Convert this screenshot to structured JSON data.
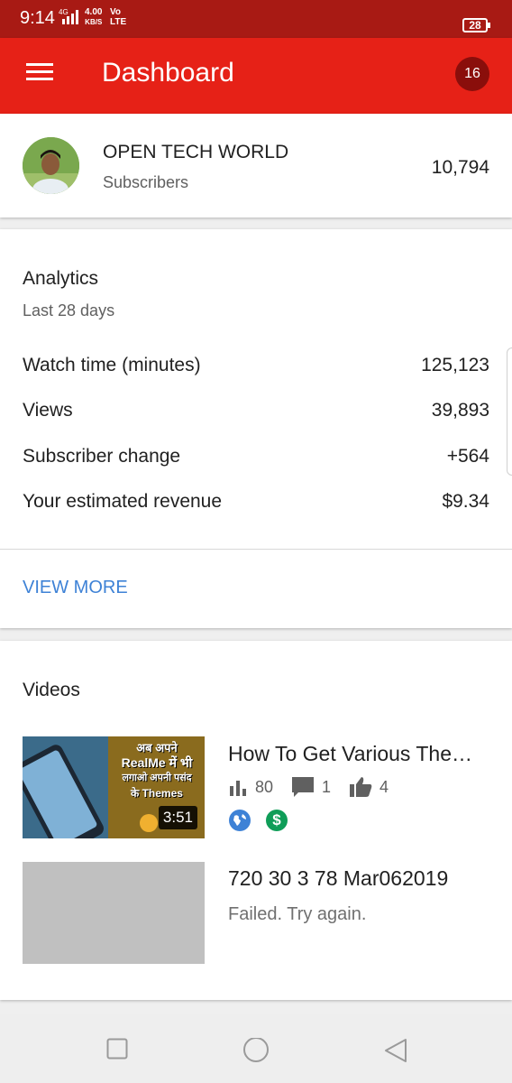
{
  "status_bar": {
    "time": "9:14",
    "network": "4G",
    "speed_value": "4.00",
    "speed_unit": "KB/S",
    "volte_top": "Vo",
    "volte_bottom": "LTE",
    "battery": "28"
  },
  "app_bar": {
    "title": "Dashboard",
    "notification_count": "16"
  },
  "channel": {
    "name": "OPEN TECH WORLD",
    "subscribers_label": "Subscribers",
    "subscribers_count": "10,794"
  },
  "analytics": {
    "title": "Analytics",
    "period": "Last 28 days",
    "metrics": [
      {
        "label": "Watch time (minutes)",
        "value": "125,123"
      },
      {
        "label": "Views",
        "value": "39,893"
      },
      {
        "label": "Subscriber change",
        "value": "+564"
      },
      {
        "label": "Your estimated revenue",
        "value": "$9.34"
      }
    ],
    "view_more": "VIEW MORE"
  },
  "videos": {
    "title": "Videos",
    "items": [
      {
        "title": "How To Get Various The…",
        "duration": "3:51",
        "views": "80",
        "comments": "1",
        "likes": "4",
        "thumb_text": [
          "अब अपने",
          "RealMe में भी",
          "लगाओ अपनी पसंद",
          "के Themes"
        ]
      },
      {
        "title": "720 30 3 78 Mar062019",
        "status": "Failed. Try again."
      }
    ]
  },
  "colors": {
    "status_bar": "#a81a14",
    "app_bar": "#e62117",
    "link": "#3e82d6",
    "money": "#0f9d58"
  }
}
